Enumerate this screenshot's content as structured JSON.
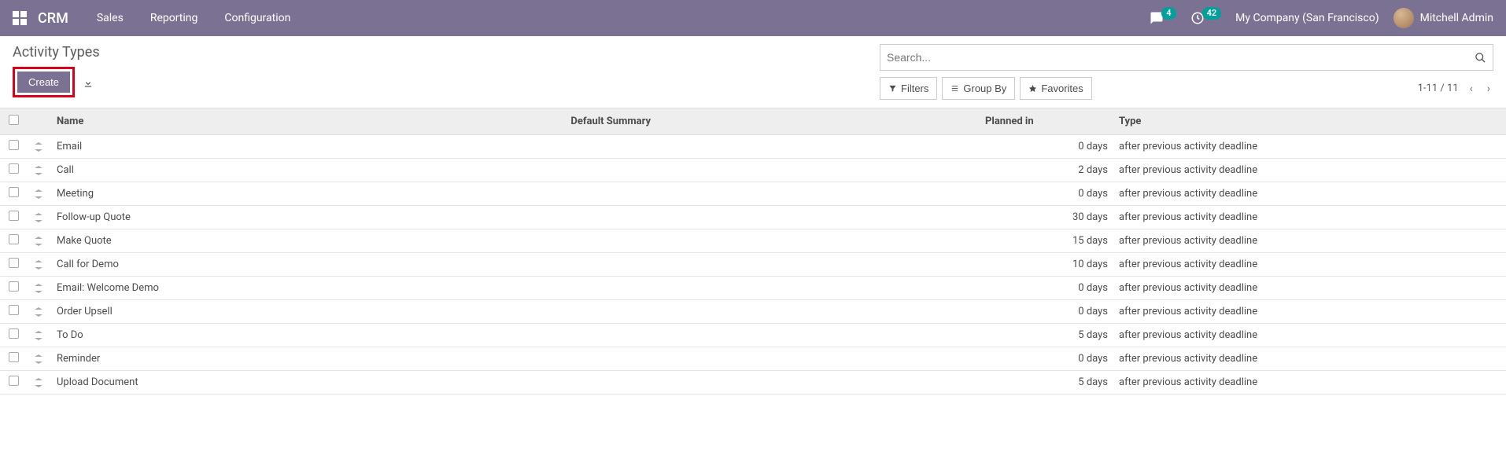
{
  "header": {
    "brand": "CRM",
    "menu": [
      "Sales",
      "Reporting",
      "Configuration"
    ],
    "chat_badge": "4",
    "clock_badge": "42",
    "company": "My Company (San Francisco)",
    "user": "Mitchell Admin"
  },
  "page": {
    "title": "Activity Types",
    "create_label": "Create",
    "search_placeholder": "Search...",
    "filters_label": "Filters",
    "groupby_label": "Group By",
    "favorites_label": "Favorites",
    "pager": "1-11 / 11"
  },
  "columns": {
    "name": "Name",
    "default_summary": "Default Summary",
    "planned_in": "Planned in",
    "type": "Type"
  },
  "rows": [
    {
      "name": "Email",
      "summary": "",
      "planned": "0 days",
      "type": "after previous activity deadline"
    },
    {
      "name": "Call",
      "summary": "",
      "planned": "2 days",
      "type": "after previous activity deadline"
    },
    {
      "name": "Meeting",
      "summary": "",
      "planned": "0 days",
      "type": "after previous activity deadline"
    },
    {
      "name": "Follow-up Quote",
      "summary": "",
      "planned": "30 days",
      "type": "after previous activity deadline"
    },
    {
      "name": "Make Quote",
      "summary": "",
      "planned": "15 days",
      "type": "after previous activity deadline"
    },
    {
      "name": "Call for Demo",
      "summary": "",
      "planned": "10 days",
      "type": "after previous activity deadline"
    },
    {
      "name": "Email: Welcome Demo",
      "summary": "",
      "planned": "0 days",
      "type": "after previous activity deadline"
    },
    {
      "name": "Order Upsell",
      "summary": "",
      "planned": "0 days",
      "type": "after previous activity deadline"
    },
    {
      "name": "To Do",
      "summary": "",
      "planned": "5 days",
      "type": "after previous activity deadline"
    },
    {
      "name": "Reminder",
      "summary": "",
      "planned": "0 days",
      "type": "after previous activity deadline"
    },
    {
      "name": "Upload Document",
      "summary": "",
      "planned": "5 days",
      "type": "after previous activity deadline"
    }
  ]
}
